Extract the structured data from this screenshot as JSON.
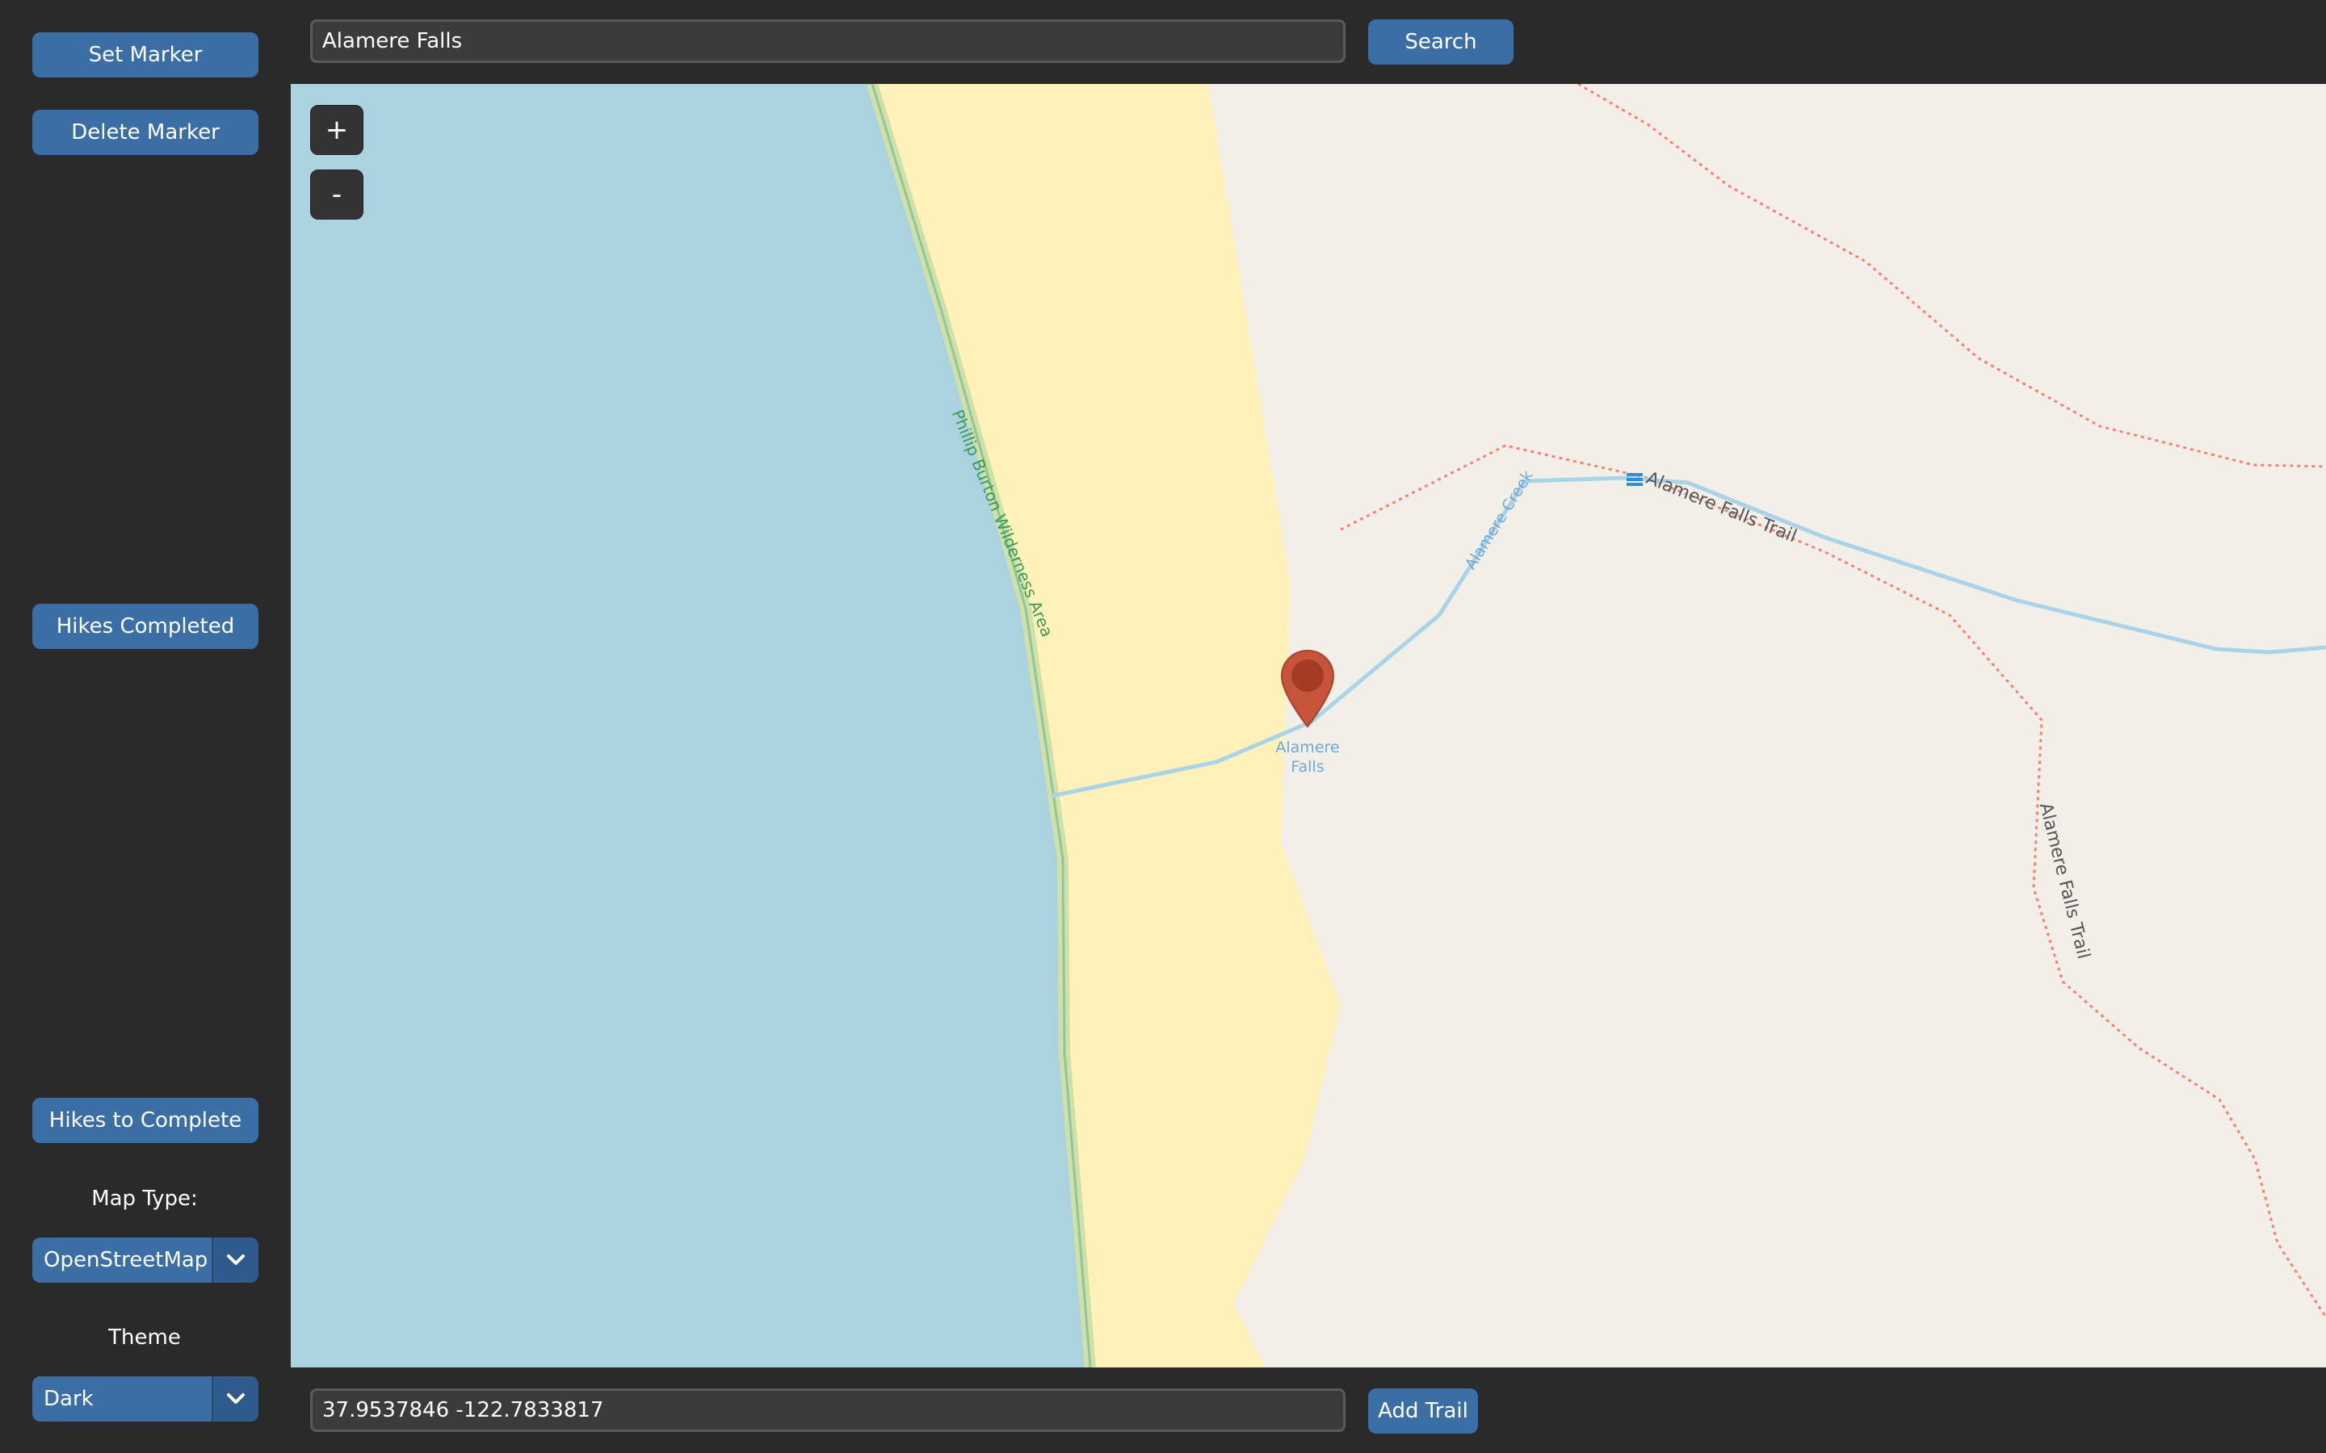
{
  "sidebar": {
    "set_marker": "Set Marker",
    "delete_marker": "Delete Marker",
    "hikes_completed": "Hikes Completed",
    "hikes_to_complete": "Hikes to Complete",
    "map_type_label": "Map Type:",
    "map_type_value": "OpenStreetMap",
    "theme_label": "Theme",
    "theme_value": "Dark"
  },
  "search": {
    "value": "Alamere Falls",
    "button": "Search"
  },
  "map": {
    "zoom_in": "+",
    "zoom_out": "-",
    "labels": {
      "wilderness": "Phillip Burton Wilderness Area",
      "creek": "Alamere Creek",
      "trail_upper": "Alamere Falls Trail",
      "trail_right": "Alamere Falls Trail",
      "marker_line1": "Alamere",
      "marker_line2": "Falls"
    },
    "colors": {
      "water": "#aad3df",
      "land": "#f2efe9",
      "beach": "#fff1ba",
      "wilderness": "#8fc79a",
      "stream": "#a9d3e6",
      "footpath": "#fa8072",
      "marker": "#c6543a"
    }
  },
  "coordinates": {
    "value": "37.9537846 -122.7833817",
    "button": "Add Trail"
  }
}
